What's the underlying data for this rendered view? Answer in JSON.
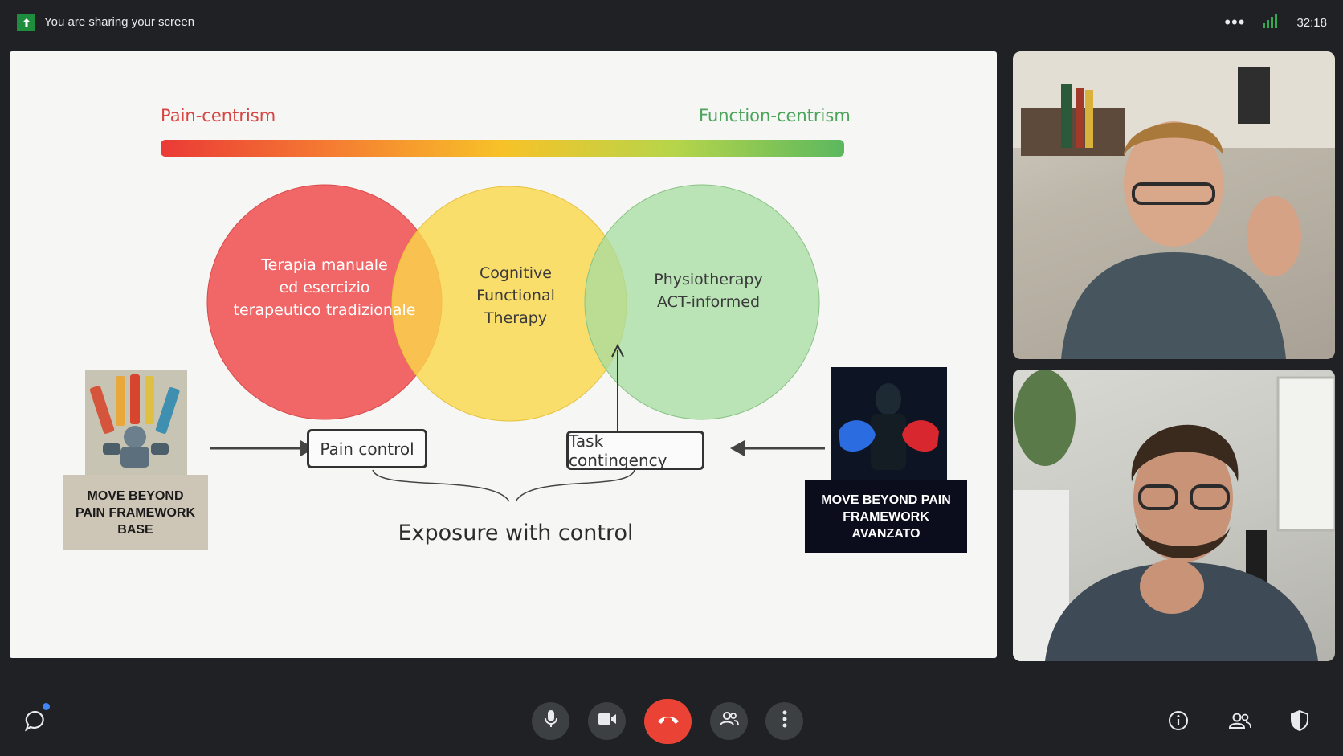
{
  "topbar": {
    "share_status": "You are sharing your screen",
    "more_icon": "more-horizontal-icon",
    "signal_icon": "signal-bars-icon",
    "clock": "32:18"
  },
  "slide": {
    "label_left": "Pain-centrism",
    "label_right": "Function-centrism",
    "circles": {
      "red": [
        "Terapia manuale",
        "ed esercizio",
        "terapeutico tradizionale"
      ],
      "yellow": [
        "Cognitive",
        "Functional",
        "Therapy"
      ],
      "green": [
        "Physiotherapy",
        "ACT-informed"
      ]
    },
    "pain_control": "Pain control",
    "task_contingency": "Task contingency",
    "exposure": "Exposure with control",
    "badge_left": {
      "lines": [
        "MOVE BEYOND",
        "PAIN FRAMEWORK",
        "BASE"
      ]
    },
    "badge_right": {
      "lines": [
        "MOVE BEYOND PAIN",
        "FRAMEWORK",
        "AVANZATO"
      ]
    },
    "colors": {
      "red": "#f0595a",
      "yellow": "#fbd84a",
      "green": "#a6dca0",
      "pain_label": "#d64541",
      "function_label": "#4aa45a"
    }
  },
  "participants": [
    {
      "tile": "participant-tile-1"
    },
    {
      "tile": "participant-tile-2"
    }
  ],
  "bottombar": {
    "chat_icon": "chat-icon",
    "mic_icon": "microphone-icon",
    "camera_icon": "video-camera-icon",
    "end_call_icon": "end-call-icon",
    "people_icon": "people-icon",
    "more_icon": "more-vertical-icon",
    "info_icon": "info-icon",
    "participants_icon": "participants-icon",
    "shield_icon": "shield-icon",
    "end_call_color": "#ea4335"
  }
}
